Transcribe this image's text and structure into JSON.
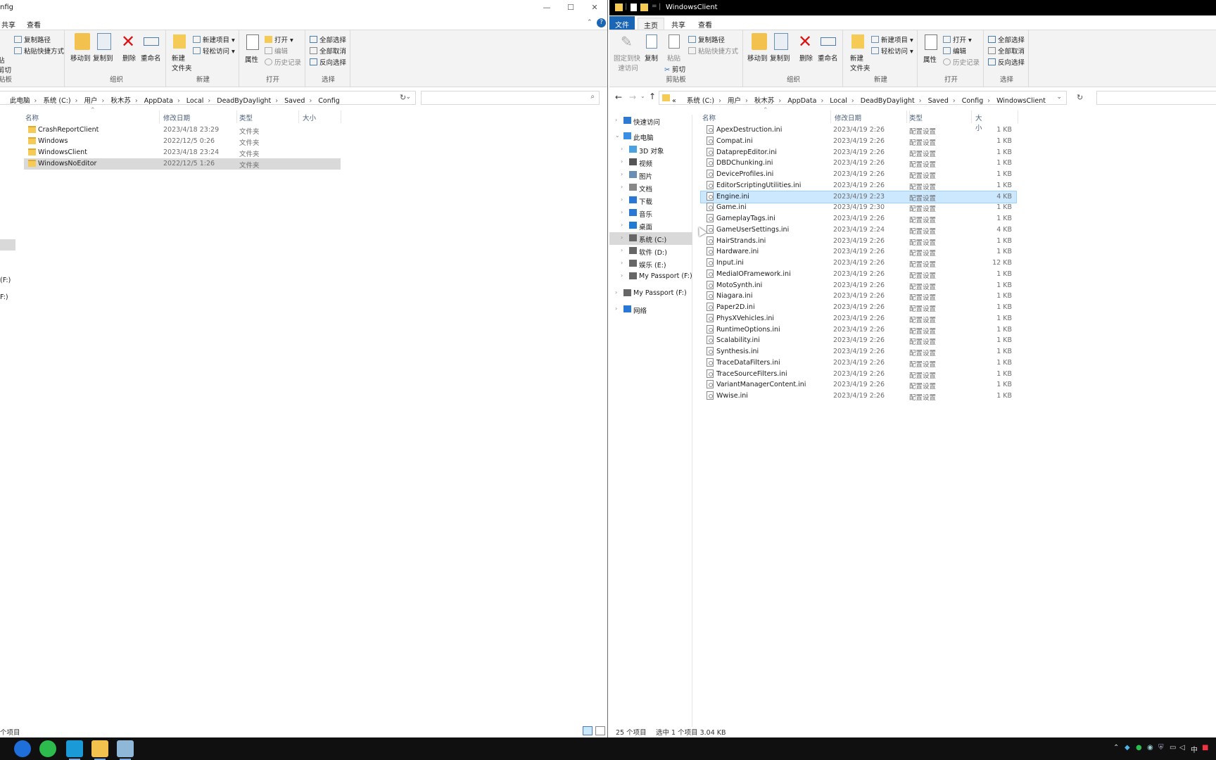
{
  "left": {
    "title": "nfig",
    "tabs": [
      "共享",
      "查看"
    ],
    "ribbon": {
      "clipboard": {
        "paste_partial": "贴",
        "cut_partial": "剪切",
        "copy_path": "复制路径",
        "paste_shortcut": "粘贴快捷方式",
        "label_partial": "贴板"
      },
      "organize": {
        "move_to": "移动到",
        "copy_to": "复制到",
        "delete": "删除",
        "rename": "重命名",
        "label": "组织"
      },
      "new": {
        "new_folder_l1": "新建",
        "new_folder_l2": "文件夹",
        "new_item": "新建项目",
        "easy_access": "轻松访问",
        "label": "新建"
      },
      "open": {
        "properties": "属性",
        "open": "打开",
        "edit": "编辑",
        "history": "历史记录",
        "label": "打开"
      },
      "select": {
        "select_all": "全部选择",
        "select_none": "全部取消",
        "invert": "反向选择",
        "label": "选择"
      }
    },
    "breadcrumb": [
      "此电脑",
      "系统 (C:)",
      "用户",
      "秋木苏",
      "AppData",
      "Local",
      "DeadByDaylight",
      "Saved",
      "Config"
    ],
    "columns": {
      "name": "名称",
      "date": "修改日期",
      "type": "类型",
      "size": "大小"
    },
    "rows": [
      {
        "name": "CrashReportClient",
        "date": "2023/4/18 23:29",
        "type": "文件夹"
      },
      {
        "name": "Windows",
        "date": "2022/12/5 0:26",
        "type": "文件夹"
      },
      {
        "name": "WindowsClient",
        "date": "2023/4/18 23:24",
        "type": "文件夹"
      },
      {
        "name": "WindowsNoEditor",
        "date": "2022/12/5 1:26",
        "type": "文件夹"
      }
    ],
    "nav_partial": [
      "(F:)",
      "F:)"
    ],
    "status": "个项目"
  },
  "right": {
    "title": "WindowsClient",
    "tabs": [
      "文件",
      "主页",
      "共享",
      "查看"
    ],
    "ribbon": {
      "clipboard": {
        "pin_l1": "固定到快",
        "pin_l2": "速访问",
        "copy": "复制",
        "paste": "粘贴",
        "copy_path": "复制路径",
        "paste_shortcut": "粘贴快捷方式",
        "cut": "剪切",
        "label": "剪贴板"
      },
      "organize": {
        "move_to": "移动到",
        "copy_to": "复制到",
        "delete": "删除",
        "rename": "重命名",
        "label": "组织"
      },
      "new": {
        "new_folder_l1": "新建",
        "new_folder_l2": "文件夹",
        "new_item": "新建项目",
        "easy_access": "轻松访问",
        "label": "新建"
      },
      "open": {
        "properties": "属性",
        "open": "打开",
        "edit": "编辑",
        "history": "历史记录",
        "label": "打开"
      },
      "select": {
        "select_all": "全部选择",
        "select_none": "全部取消",
        "invert": "反向选择",
        "label": "选择"
      }
    },
    "breadcrumb_prefix": "«",
    "breadcrumb": [
      "系统 (C:)",
      "用户",
      "秋木苏",
      "AppData",
      "Local",
      "DeadByDaylight",
      "Saved",
      "Config",
      "WindowsClient"
    ],
    "nav": [
      {
        "label": "快速访问",
        "icon": "star-icon",
        "color": "#2f7ad1"
      },
      {
        "label": "此电脑",
        "icon": "computer-icon",
        "color": "#3a8ee6"
      },
      {
        "label": "3D 对象",
        "icon": "cube-icon",
        "color": "#4aa3e0"
      },
      {
        "label": "视频",
        "icon": "video-icon",
        "color": "#555"
      },
      {
        "label": "图片",
        "icon": "picture-icon",
        "color": "#6a8fb5"
      },
      {
        "label": "文档",
        "icon": "document-icon",
        "color": "#888"
      },
      {
        "label": "下载",
        "icon": "download-icon",
        "color": "#2a78d6"
      },
      {
        "label": "音乐",
        "icon": "music-icon",
        "color": "#2a78d6"
      },
      {
        "label": "桌面",
        "icon": "desktop-icon",
        "color": "#1f7ad6"
      },
      {
        "label": "系统 (C:)",
        "icon": "drive-icon",
        "color": "#666"
      },
      {
        "label": "软件 (D:)",
        "icon": "drive-icon",
        "color": "#666"
      },
      {
        "label": "娱乐 (E:)",
        "icon": "drive-icon",
        "color": "#666"
      },
      {
        "label": "My Passport (F:)",
        "icon": "drive-icon",
        "color": "#666"
      },
      {
        "label": "My Passport (F:)",
        "icon": "drive-icon",
        "color": "#666"
      },
      {
        "label": "网络",
        "icon": "network-icon",
        "color": "#2a78d6"
      }
    ],
    "columns": {
      "name": "名称",
      "date": "修改日期",
      "type": "类型",
      "size": "大小"
    },
    "rows": [
      {
        "name": "ApexDestruction.ini",
        "date": "2023/4/19 2:26",
        "type": "配置设置",
        "size": "1 KB"
      },
      {
        "name": "Compat.ini",
        "date": "2023/4/19 2:26",
        "type": "配置设置",
        "size": "1 KB"
      },
      {
        "name": "DataprepEditor.ini",
        "date": "2023/4/19 2:26",
        "type": "配置设置",
        "size": "1 KB"
      },
      {
        "name": "DBDChunking.ini",
        "date": "2023/4/19 2:26",
        "type": "配置设置",
        "size": "1 KB"
      },
      {
        "name": "DeviceProfiles.ini",
        "date": "2023/4/19 2:26",
        "type": "配置设置",
        "size": "1 KB"
      },
      {
        "name": "EditorScriptingUtilities.ini",
        "date": "2023/4/19 2:26",
        "type": "配置设置",
        "size": "1 KB"
      },
      {
        "name": "Engine.ini",
        "date": "2023/4/19 2:23",
        "type": "配置设置",
        "size": "4 KB"
      },
      {
        "name": "Game.ini",
        "date": "2023/4/19 2:30",
        "type": "配置设置",
        "size": "1 KB"
      },
      {
        "name": "GameplayTags.ini",
        "date": "2023/4/19 2:26",
        "type": "配置设置",
        "size": "1 KB"
      },
      {
        "name": "GameUserSettings.ini",
        "date": "2023/4/19 2:24",
        "type": "配置设置",
        "size": "4 KB"
      },
      {
        "name": "HairStrands.ini",
        "date": "2023/4/19 2:26",
        "type": "配置设置",
        "size": "1 KB"
      },
      {
        "name": "Hardware.ini",
        "date": "2023/4/19 2:26",
        "type": "配置设置",
        "size": "1 KB"
      },
      {
        "name": "Input.ini",
        "date": "2023/4/19 2:26",
        "type": "配置设置",
        "size": "12 KB"
      },
      {
        "name": "MediaIOFramework.ini",
        "date": "2023/4/19 2:26",
        "type": "配置设置",
        "size": "1 KB"
      },
      {
        "name": "MotoSynth.ini",
        "date": "2023/4/19 2:26",
        "type": "配置设置",
        "size": "1 KB"
      },
      {
        "name": "Niagara.ini",
        "date": "2023/4/19 2:26",
        "type": "配置设置",
        "size": "1 KB"
      },
      {
        "name": "Paper2D.ini",
        "date": "2023/4/19 2:26",
        "type": "配置设置",
        "size": "1 KB"
      },
      {
        "name": "PhysXVehicles.ini",
        "date": "2023/4/19 2:26",
        "type": "配置设置",
        "size": "1 KB"
      },
      {
        "name": "RuntimeOptions.ini",
        "date": "2023/4/19 2:26",
        "type": "配置设置",
        "size": "1 KB"
      },
      {
        "name": "Scalability.ini",
        "date": "2023/4/19 2:26",
        "type": "配置设置",
        "size": "1 KB"
      },
      {
        "name": "Synthesis.ini",
        "date": "2023/4/19 2:26",
        "type": "配置设置",
        "size": "1 KB"
      },
      {
        "name": "TraceDataFilters.ini",
        "date": "2023/4/19 2:26",
        "type": "配置设置",
        "size": "1 KB"
      },
      {
        "name": "TraceSourceFilters.ini",
        "date": "2023/4/19 2:26",
        "type": "配置设置",
        "size": "1 KB"
      },
      {
        "name": "VariantManagerContent.ini",
        "date": "2023/4/19 2:26",
        "type": "配置设置",
        "size": "1 KB"
      },
      {
        "name": "Wwise.ini",
        "date": "2023/4/19 2:26",
        "type": "配置设置",
        "size": "1 KB"
      }
    ],
    "status": {
      "count": "25 个项目",
      "selected": "选中 1 个项目  3.04 KB"
    }
  },
  "tray": {
    "ime": "中"
  },
  "colors": {
    "accent": "#1a65b4",
    "selection": "#cce8ff",
    "selection_inactive": "#d9d9d9",
    "taskbar": "#101010"
  }
}
